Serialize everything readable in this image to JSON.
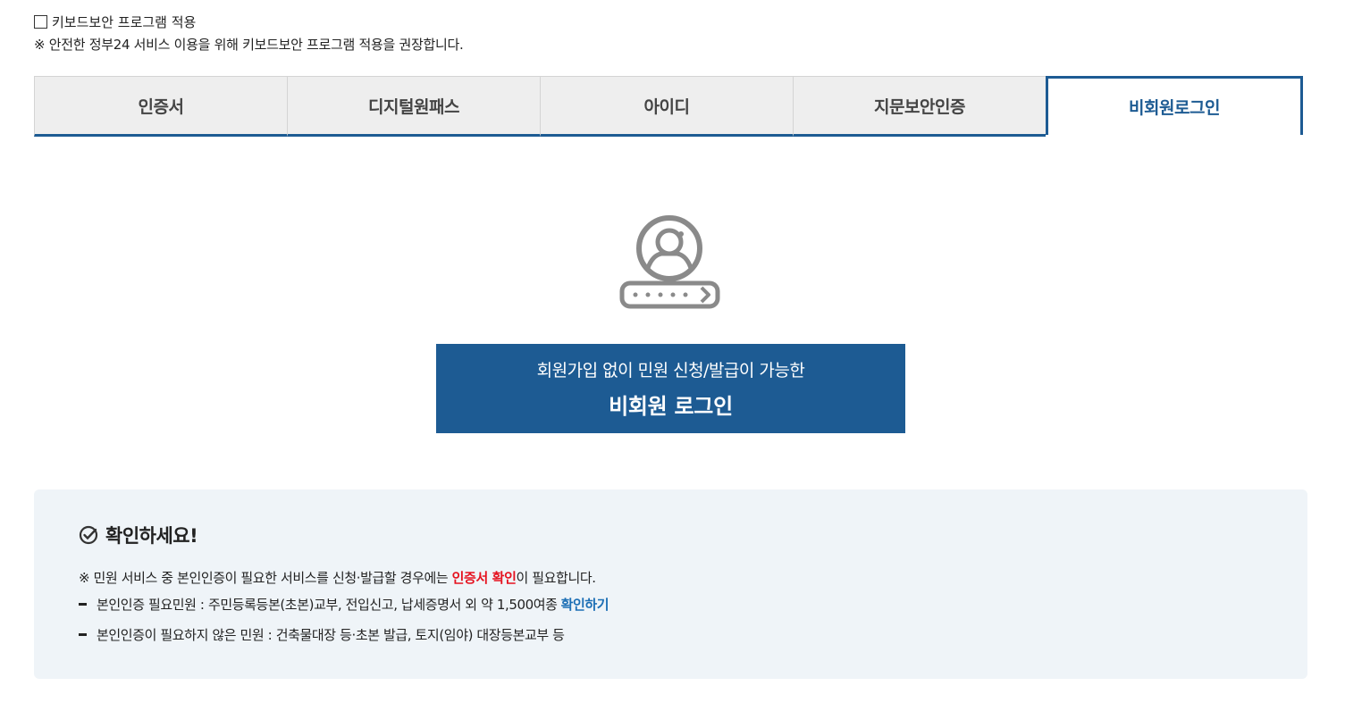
{
  "keyboard_security": {
    "label": "키보드보안 프로그램 적용",
    "note": "※ 안전한 정부24 서비스 이용을 위해 키보드보안 프로그램 적용을 권장합니다."
  },
  "tabs": [
    {
      "label": "인증서"
    },
    {
      "label": "디지털원패스"
    },
    {
      "label": "아이디"
    },
    {
      "label": "지문보안인증"
    },
    {
      "label": "비회원로그인"
    }
  ],
  "nonmember": {
    "icon": "user-password-icon",
    "button_sub": "회원가입 없이 민원 신청/발급이 가능한",
    "button_main": "비회원 로그인"
  },
  "notice": {
    "title": "확인하세요!",
    "line1_prefix": "※ 민원 서비스 중 본인인증이 필요한 서비스를 신청·발급할 경우에는 ",
    "line1_highlight": "인증서 확인",
    "line1_suffix": "이 필요합니다.",
    "line2_text": "본인인증 필요민원 : 주민등록등본(초본)교부, 전입신고, 납세증명서 외 약 1,500여종",
    "line2_link": "확인하기",
    "line3_text": "본인인증이 필요하지 않은 민원 : 건축물대장 등·초본 발급, 토지(임야) 대장등본교부 등"
  },
  "colors": {
    "primary": "#1d5b93",
    "highlight_red": "#e5111e",
    "link_blue": "#1d6fb5",
    "notice_bg": "#eff4f8"
  }
}
